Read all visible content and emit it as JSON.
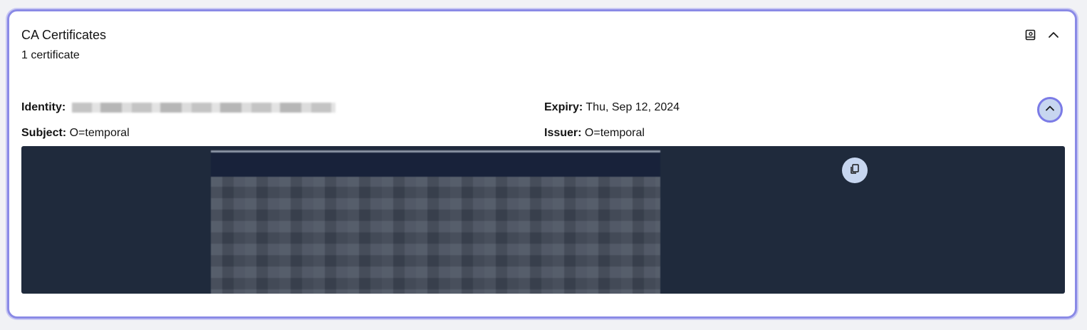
{
  "card": {
    "title": "CA Certificates",
    "subtitle": "1 certificate",
    "export_icon": "export-icon",
    "collapse_icon": "chevron-up-icon"
  },
  "certificate": {
    "identity_label": "Identity:",
    "identity_value": "(redacted)",
    "subject_label": "Subject:",
    "subject_value": "O=temporal",
    "expiry_label": "Expiry:",
    "expiry_value": "Thu, Sep 12, 2024",
    "issuer_label": "Issuer:",
    "issuer_value": "O=temporal",
    "toggle_icon": "chevron-up-icon",
    "copy_icon": "copy-icon",
    "pem": "(redacted)"
  },
  "colors": {
    "accent_border": "#8a8ae6",
    "code_background": "#1f2a3c",
    "button_background": "#c7d6f0"
  }
}
